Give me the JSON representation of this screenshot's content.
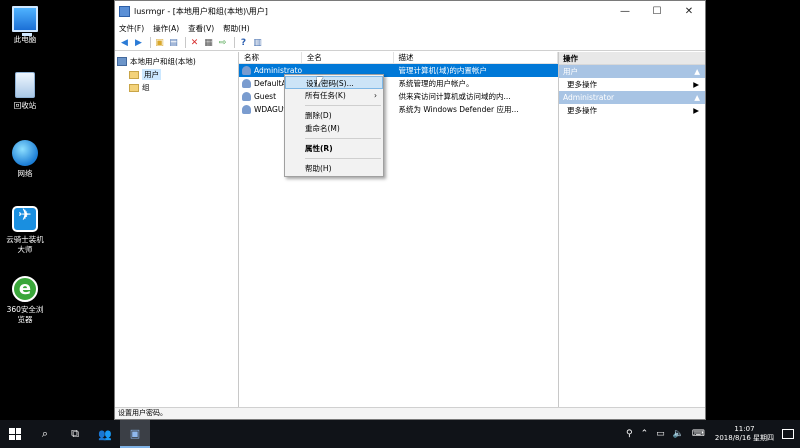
{
  "desktop": {
    "icons": [
      {
        "label": "此电脑",
        "icon": "computer-icon"
      },
      {
        "label": "回收站",
        "icon": "recycle-bin-icon"
      },
      {
        "label": "网络",
        "icon": "network-icon"
      },
      {
        "label": "云骑士装机大师",
        "icon": "yunqishi-app-icon"
      },
      {
        "label": "360安全浏览器",
        "icon": "360-browser-icon"
      }
    ]
  },
  "window": {
    "title": "lusrmgr - [本地用户和组(本地)\\用户]",
    "controls": {
      "minimize": "—",
      "maximize": "☐",
      "close": "✕"
    },
    "menu": [
      "文件(F)",
      "操作(A)",
      "查看(V)",
      "帮助(H)"
    ],
    "toolbar_icons": [
      "back-icon",
      "forward-icon",
      "up-folder-icon",
      "show-hide-tree-icon",
      "delete-icon",
      "properties-icon",
      "export-icon",
      "help-icon",
      "action-pane-icon"
    ],
    "tree": {
      "root": "本地用户和组(本地)",
      "children": [
        "用户",
        "组"
      ]
    },
    "list": {
      "headers": [
        "名称",
        "全名",
        "描述"
      ],
      "rows": [
        {
          "name": "Administrator",
          "fullname": "",
          "desc": "管理计算机(域)的内置帐户"
        },
        {
          "name": "DefaultAccount",
          "fullname": "",
          "desc": "系统管理的用户帐户。"
        },
        {
          "name": "Guest",
          "fullname": "",
          "desc": "供来宾访问计算机或访问域的内..."
        },
        {
          "name": "WDAGUtilityAccount",
          "fullname": "",
          "desc": "系统为 Windows Defender 应用..."
        }
      ]
    },
    "actions": {
      "header": "操作",
      "sections": [
        {
          "title": "用户",
          "items": [
            "更多操作"
          ]
        },
        {
          "title": "Administrator",
          "items": [
            "更多操作"
          ]
        }
      ]
    },
    "status": "设置用户密码。"
  },
  "context_menu": {
    "items": [
      {
        "label": "设置密码(S)...",
        "highlight": true
      },
      {
        "label": "所有任务(K)",
        "submenu": true
      },
      {
        "sep": true
      },
      {
        "label": "删除(D)"
      },
      {
        "label": "重命名(M)"
      },
      {
        "sep": true
      },
      {
        "label": "属性(R)",
        "bold": true
      },
      {
        "sep": true
      },
      {
        "label": "帮助(H)"
      }
    ]
  },
  "taskbar": {
    "time": "11:07",
    "date": "2018/8/16 星期四"
  }
}
